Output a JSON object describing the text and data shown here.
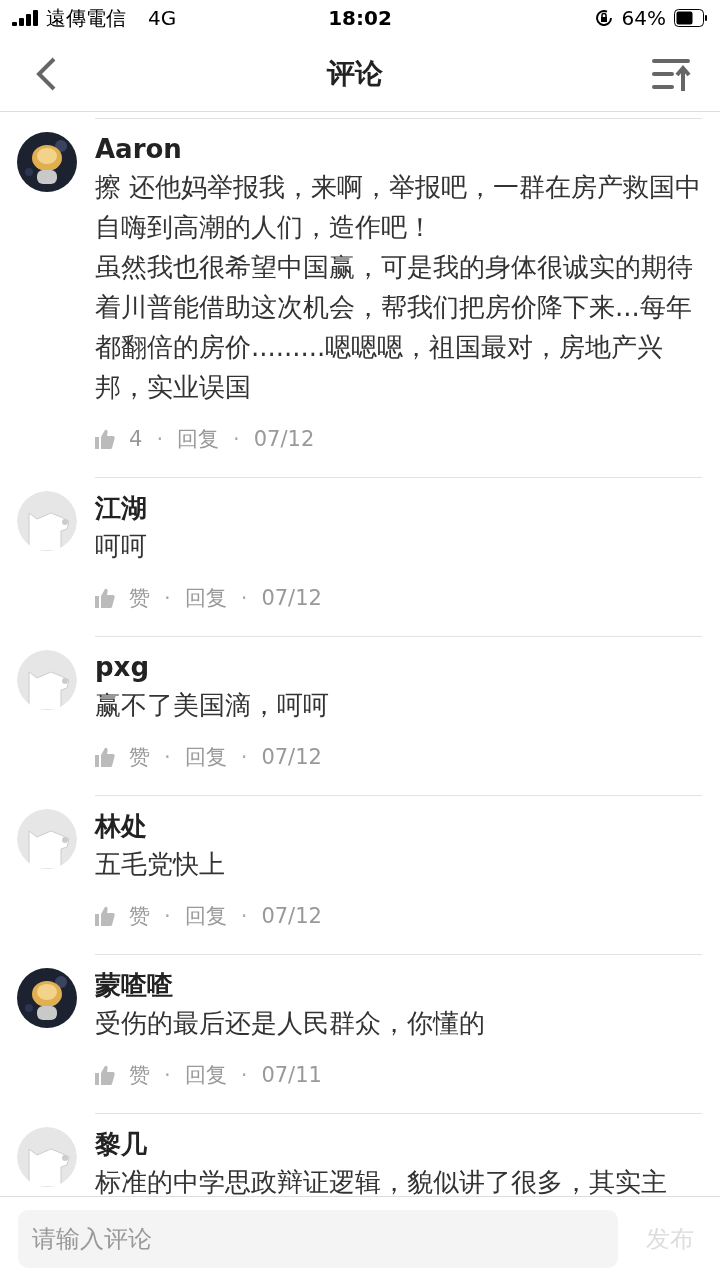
{
  "status_bar": {
    "carrier": "遠傳電信",
    "network": "4G",
    "time": "18:02",
    "battery": "64%"
  },
  "header": {
    "title": "评论"
  },
  "comments": [
    {
      "avatar": {
        "kind": "picture"
      },
      "name": "Aaron",
      "paragraphs": [
        "擦 还他妈举报我，来啊，举报吧，一群在房产救国中自嗨到高潮的人们，造作吧！",
        "虽然我也很希望中国赢，可是我的身体很诚实的期待着川普能借助这次机会，帮我们把房价降下来...每年都翻倍的房价.........嗯嗯嗯，祖国最对，房地产兴邦，实业误国"
      ],
      "likes": "4",
      "separator_1": "·",
      "reply": "回复",
      "separator_2": "·",
      "date": "07/12"
    },
    {
      "avatar": {
        "kind": "default"
      },
      "name": "江湖",
      "paragraphs": [
        "呵呵"
      ],
      "likes": "赞",
      "separator_1": "·",
      "reply": "回复",
      "separator_2": "·",
      "date": "07/12"
    },
    {
      "avatar": {
        "kind": "default"
      },
      "name": "pxg",
      "paragraphs": [
        "赢不了美国滴，呵呵"
      ],
      "likes": "赞",
      "separator_1": "·",
      "reply": "回复",
      "separator_2": "·",
      "date": "07/12"
    },
    {
      "avatar": {
        "kind": "default"
      },
      "name": "林处",
      "paragraphs": [
        "五毛党快上"
      ],
      "likes": "赞",
      "separator_1": "·",
      "reply": "回复",
      "separator_2": "·",
      "date": "07/12"
    },
    {
      "avatar": {
        "kind": "picture"
      },
      "name": "蒙喳喳",
      "paragraphs": [
        "受伤的最后还是人民群众，你懂的"
      ],
      "likes": "赞",
      "separator_1": "·",
      "reply": "回复",
      "separator_2": "·",
      "date": "07/11"
    },
    {
      "avatar": {
        "kind": "default"
      },
      "name": "黎几",
      "paragraphs": [
        "标准的中学思政辩证逻辑，貌似讲了很多，其实主"
      ]
    }
  ],
  "composer": {
    "placeholder": "请输入评论",
    "send": "发布",
    "send_disabled": true
  }
}
